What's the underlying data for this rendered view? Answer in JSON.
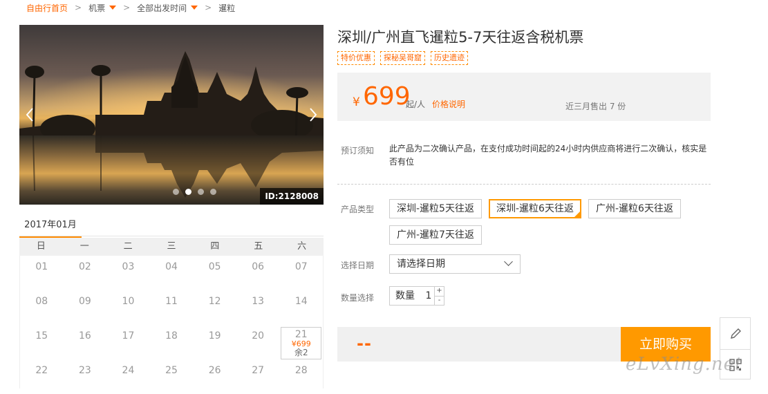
{
  "breadcrumb": {
    "home": "自由行首页",
    "items": [
      "机票",
      "全部出发时间",
      "暹粒"
    ],
    "separator": ">"
  },
  "gallery": {
    "image_id": "ID:2128008",
    "prev_icon": "chevron-left-icon",
    "next_icon": "chevron-right-icon",
    "dots_count": 4,
    "active_dot": 1
  },
  "calendar": {
    "month": "2017年01月",
    "weekdays": [
      "日",
      "一",
      "二",
      "三",
      "四",
      "五",
      "六"
    ],
    "rows": [
      [
        "01",
        "02",
        "03",
        "04",
        "05",
        "06",
        "07"
      ],
      [
        "08",
        "09",
        "10",
        "11",
        "12",
        "13",
        "14"
      ],
      [
        "15",
        "16",
        "17",
        "18",
        "19",
        "20",
        "21"
      ],
      [
        "22",
        "23",
        "24",
        "25",
        "26",
        "27",
        "28"
      ]
    ],
    "available": {
      "day": "21",
      "price": "¥699",
      "remaining": "余2"
    }
  },
  "product": {
    "title": "深圳/广州直飞暹粒5-7天往返含税机票",
    "tags": [
      "特价优惠",
      "探秘吴哥窟",
      "历史遗迹"
    ],
    "price": {
      "symbol": "¥",
      "amount": "699",
      "unit": "起/人",
      "explain": "价格说明"
    },
    "sold": "近三月售出 7 份"
  },
  "booking": {
    "notice_label": "预订须知",
    "notice_text": "此产品为二次确认产品，在支付成功时间起的24小时内供应商将进行二次确认，核实是否有位",
    "type_label": "产品类型",
    "types": [
      "深圳-暹粒5天往返",
      "深圳-暹粒6天往返",
      "广州-暹粒6天往返",
      "广州-暹粒7天往返"
    ],
    "selected_type": 1,
    "date_label": "选择日期",
    "date_placeholder": "请选择日期",
    "qty_label": "数量选择",
    "qty_text": "数量",
    "qty_value": "1",
    "qty_plus": "+",
    "qty_minus": "-",
    "total": "--",
    "buy_label": "立即购买"
  },
  "side_tools": [
    "pencil-icon",
    "qrcode-icon"
  ],
  "watermark": "eLvXing.net",
  "colors": {
    "accent": "#ff6600",
    "button": "#ff9900",
    "tag_border": "#ff8a00"
  }
}
